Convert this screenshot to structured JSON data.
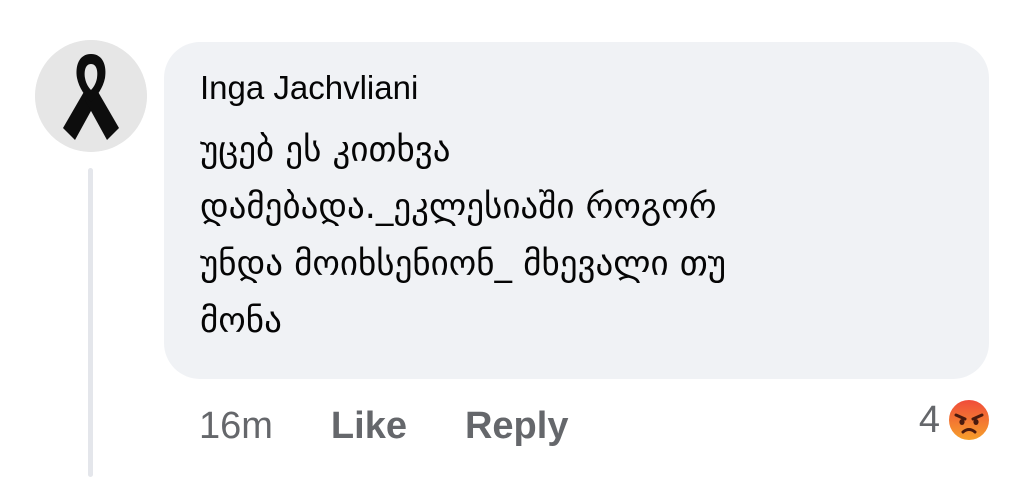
{
  "comment": {
    "author": "Inga Jachvliani",
    "avatar_icon": "black-ribbon-icon",
    "text_lines": [
      "უცებ ეს კითხვა",
      "დამებადა._ეკლესიაში როგორ",
      "უნდა მოიხსენიონ_ მხევალი თუ",
      "მონა"
    ],
    "timestamp": "16m",
    "like_label": "Like",
    "reply_label": "Reply",
    "reaction_count": "4",
    "reaction_icon": "angry-reaction-icon"
  },
  "colors": {
    "bubble": "#f0f2f5",
    "secondary_text": "#65676b",
    "angry_reaction": "#f0612b"
  }
}
